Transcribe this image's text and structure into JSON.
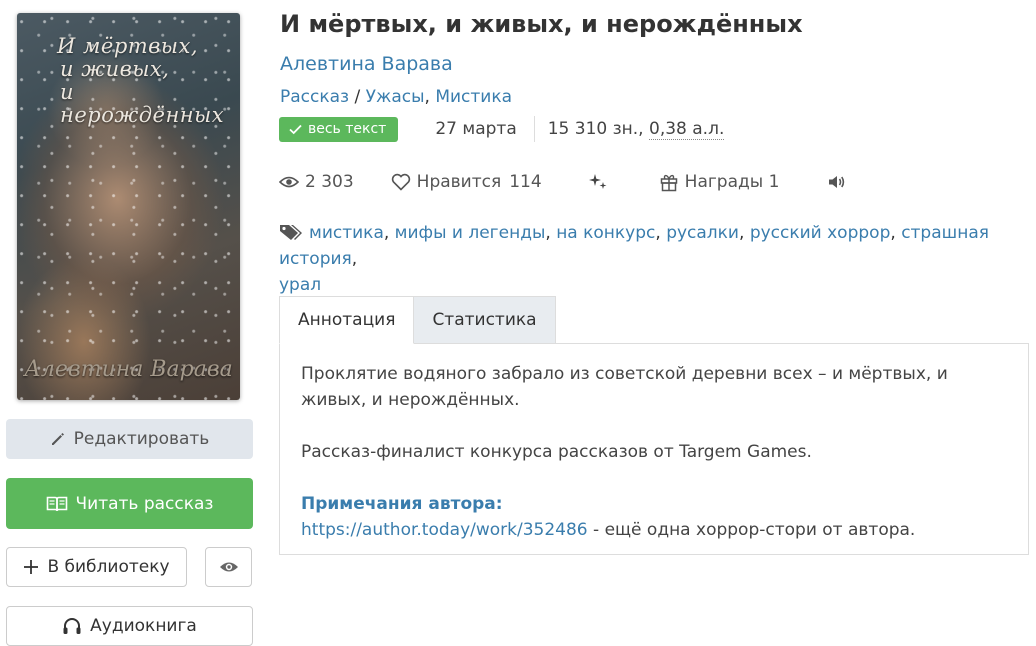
{
  "cover": {
    "title_lines": [
      "И мёртвых,",
      "и живых,",
      "и нерождённых"
    ],
    "author": "Алевтина Варава"
  },
  "sidebar": {
    "edit_label": "Редактировать",
    "read_label": "Читать рассказ",
    "library_label": "В библиотеку",
    "audio_label": "Аудиокнига"
  },
  "book": {
    "title": "И мёртвых, и живых, и нерождённых",
    "author": "Алевтина Варава",
    "form": "Рассказ",
    "genre_sep": " / ",
    "genres": [
      "Ужасы",
      "Мистика"
    ],
    "genre_comma": ", ",
    "full_text_badge": "весь текст",
    "date": "27 марта",
    "size_chars": "15 310 зн., ",
    "size_al": "0,38 а.л."
  },
  "stats": {
    "views": "2 303",
    "likes_label": "Нравится",
    "likes_count": "114",
    "awards_label": "Награды 1"
  },
  "tags": [
    "мистика",
    "мифы и легенды",
    "на конкурс",
    "русалки",
    "русский хоррор",
    "страшная история",
    "урал"
  ],
  "tabs": {
    "annotation": "Аннотация",
    "statistics": "Статистика"
  },
  "annotation": {
    "paragraph1": "Проклятие водяного забрало из советской деревни всех – и мёртвых, и живых, и нерождённых.",
    "paragraph2": "Рассказ-финалист конкурса рассказов от Targem Games.",
    "notes_title": "Примечания автора:",
    "notes_link": "https://author.today/work/352486",
    "notes_text": " - ещё одна хоррор-стори от автора."
  },
  "colors": {
    "link": "#3a7dad",
    "green": "#5cb85c",
    "edit_bg": "#e1e6ec",
    "tab_inactive_bg": "#e8ecf0"
  }
}
